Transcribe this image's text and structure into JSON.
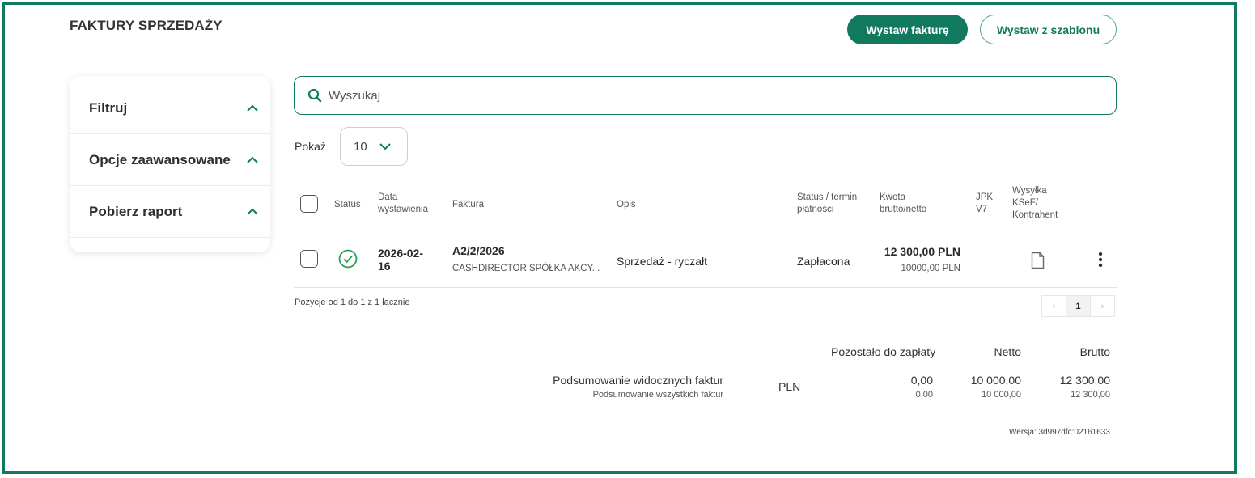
{
  "page": {
    "title": "FAKTURY SPRZEDAŻY"
  },
  "toolbar": {
    "issue_invoice_label": "Wystaw fakturę",
    "issue_from_template_label": "Wystaw z szablonu"
  },
  "sidebar": {
    "items": [
      {
        "label": "Filtruj"
      },
      {
        "label": "Opcje zaawansowane"
      },
      {
        "label": "Pobierz raport"
      }
    ]
  },
  "search": {
    "placeholder": "Wyszukaj"
  },
  "show": {
    "label": "Pokaż",
    "value": "10"
  },
  "table": {
    "headers": {
      "status": "Status",
      "issue_date_1": "Data",
      "issue_date_2": "wystawienia",
      "invoice": "Faktura",
      "description": "Opis",
      "payment_status_1": "Status / termin",
      "payment_status_2": "płatności",
      "amount_1": "Kwota",
      "amount_2": "brutto/netto",
      "jpk_1": "JPK",
      "jpk_2": "V7",
      "ksef_1": "Wysyłka",
      "ksef_2": "KSeF/",
      "ksef_3": "Kontrahent"
    },
    "rows": [
      {
        "date_1": "2026-02-",
        "date_2": "16",
        "invoice_number": "A2/2/2026",
        "contractor": "CASHDIRECTOR SPÓŁKA AKCY...",
        "description": "Sprzedaż - ryczałt",
        "payment_status": "Zapłacona",
        "gross": "12 300,00 PLN",
        "net": "10000,00 PLN"
      }
    ]
  },
  "pagination": {
    "info": "Pozycje od 1 do 1 z 1 łącznie",
    "prev": "‹",
    "current": "1",
    "next": "›"
  },
  "summary": {
    "headers": {
      "remaining": "Pozostało do zapłaty",
      "net": "Netto",
      "gross": "Brutto"
    },
    "visible_label": "Podsumowanie widocznych faktur",
    "all_label": "Podsumowanie wszystkich faktur",
    "currency": "PLN",
    "visible": {
      "remaining": "0,00",
      "net": "10 000,00",
      "gross": "12 300,00"
    },
    "all": {
      "remaining": "0,00",
      "net": "10 000,00",
      "gross": "12 300,00"
    }
  },
  "version": "Wersja: 3d997dfc:02161633",
  "colors": {
    "accent": "#117a5e",
    "success": "#2f9e55"
  }
}
